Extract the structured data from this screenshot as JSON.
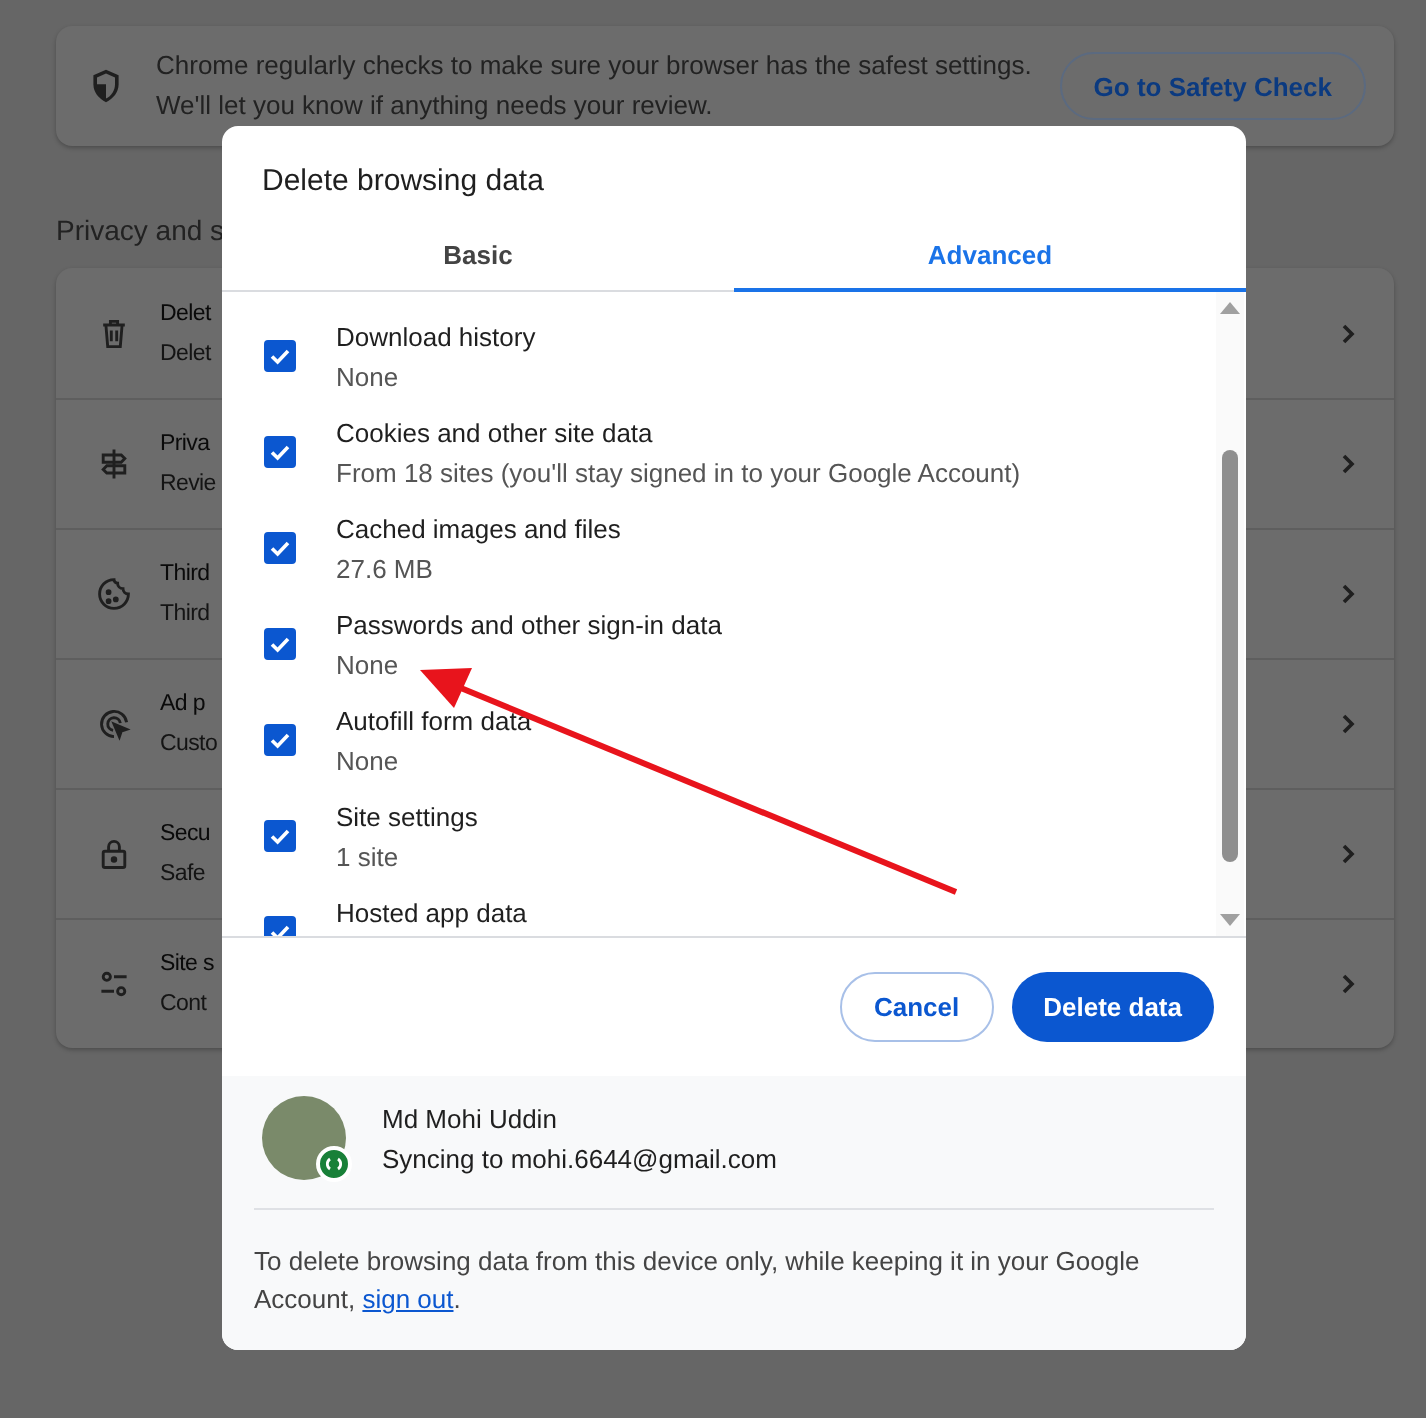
{
  "safety_card": {
    "lines": [
      "Chrome regularly checks to make sure your browser has the safest settings.",
      "We'll let you know if anything needs your review."
    ],
    "button": "Go to Safety Check"
  },
  "section_heading": "Privacy and s",
  "settings_rows": [
    {
      "kind": "trash",
      "title": "Delet",
      "subtitle": "Delet"
    },
    {
      "kind": "signpost",
      "title": "Priva",
      "subtitle": "Revie"
    },
    {
      "kind": "cookie",
      "title": "Third",
      "subtitle": "Third"
    },
    {
      "kind": "target",
      "title": "Ad p",
      "subtitle": "Custo"
    },
    {
      "kind": "lock",
      "title": "Secu",
      "subtitle": "Safe"
    },
    {
      "kind": "sliders",
      "title": "Site s",
      "subtitle": "Cont"
    }
  ],
  "dialog": {
    "title": "Delete browsing data",
    "tabs": [
      {
        "label": "Basic",
        "selected": false
      },
      {
        "label": "Advanced",
        "selected": true
      }
    ],
    "items": [
      {
        "label": "Download history",
        "detail": "None",
        "checked": true
      },
      {
        "label": "Cookies and other site data",
        "detail": "From 18 sites (you'll stay signed in to your Google Account)",
        "checked": true
      },
      {
        "label": "Cached images and files",
        "detail": "27.6 MB",
        "checked": true
      },
      {
        "label": "Passwords and other sign-in data",
        "detail": "None",
        "checked": true
      },
      {
        "label": "Autofill form data",
        "detail": "None",
        "checked": true
      },
      {
        "label": "Site settings",
        "detail": "1 site",
        "checked": true
      },
      {
        "label": "Hosted app data",
        "checked": true
      }
    ],
    "buttons": [
      {
        "kind": "secondary",
        "label": "Cancel"
      },
      {
        "kind": "primary",
        "label": "Delete data"
      }
    ],
    "account": {
      "name": "Md Mohi Uddin",
      "status": "Syncing to mohi.6644@gmail.com"
    },
    "note": {
      "text": "To delete browsing data from this device only, while keeping it in your Google Account, ",
      "link": "sign out",
      "end": "."
    }
  }
}
